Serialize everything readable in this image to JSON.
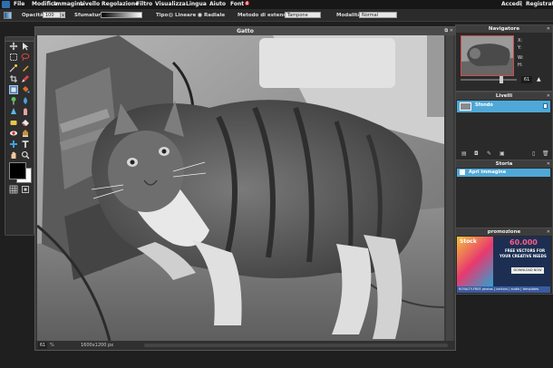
{
  "menu": {
    "items": [
      "File",
      "Modifica",
      "Immagine",
      "Livello",
      "Regolazione",
      "Filtro",
      "Visualizza",
      "Lingua",
      "Aiuto",
      "Font"
    ],
    "font_badge": "4",
    "right": [
      "Accedi",
      "Registrati"
    ]
  },
  "options": {
    "opacity_label": "Opacità:",
    "opacity_value": "100",
    "gradient_label": "Sfumatura:",
    "type_label": "Tipo:",
    "type_linear": "Lineare",
    "type_radial": "Radiale",
    "extension_label": "Metodo di estensione",
    "extension_value": "Tampone",
    "mode_label": "Modalità:",
    "mode_value": "Normal"
  },
  "canvas": {
    "title": "Gatto",
    "zoom": "61",
    "dimensions": "1600x1200 px"
  },
  "navigator": {
    "title": "Navigatore",
    "x_label": "X:",
    "y_label": "Y:",
    "w_label": "W:",
    "h_label": "H:",
    "zoom": "61"
  },
  "layers": {
    "title": "Livelli",
    "items": [
      {
        "name": "Sfondo"
      }
    ]
  },
  "history": {
    "title": "Storia",
    "items": [
      {
        "name": "Apri immagine"
      }
    ]
  },
  "promo": {
    "title": "promozione",
    "brand": "Stock",
    "big_number": "60.000",
    "headline_line1": "FREE VECTORS FOR",
    "headline_line2": "YOUR CREATIVE NEEDS",
    "button": "DOWNLOAD NOW",
    "footer": "ROYALTY-FREE  photos | vectors | audio | templates"
  },
  "colors": {
    "accent": "#5fa9d6",
    "layer_row": "#4fa8d8",
    "badge": "#d9262a",
    "bg": "#1f1f1f"
  }
}
